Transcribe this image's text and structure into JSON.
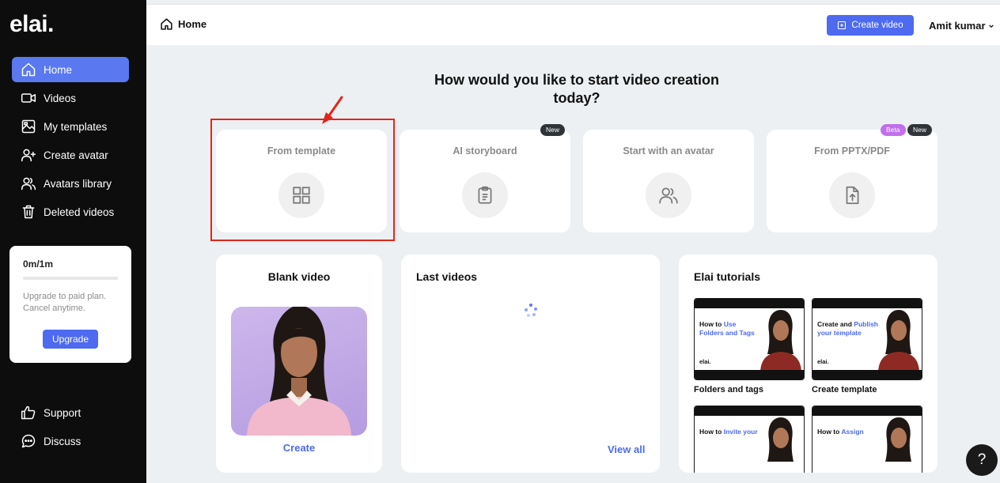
{
  "brand": {
    "logo": "elai."
  },
  "sidebar": {
    "items": [
      {
        "label": "Home",
        "icon": "home-icon",
        "active": true
      },
      {
        "label": "Videos",
        "icon": "video-camera-icon"
      },
      {
        "label": "My templates",
        "icon": "templates-icon"
      },
      {
        "label": "Create avatar",
        "icon": "user-plus-icon"
      },
      {
        "label": "Avatars library",
        "icon": "users-icon"
      },
      {
        "label": "Deleted videos",
        "icon": "trash-icon"
      }
    ],
    "bottom_items": [
      {
        "label": "Support",
        "icon": "thumbs-up-icon"
      },
      {
        "label": "Discuss",
        "icon": "chat-icon"
      }
    ],
    "plan": {
      "usage": "0m/1m",
      "progress": 0,
      "text_line1": "Upgrade to paid plan.",
      "text_line2": "Cancel anytime.",
      "upgrade_label": "Upgrade"
    }
  },
  "topbar": {
    "breadcrumb": "Home",
    "create_video_label": "Create video",
    "user_name": "Amit kumar"
  },
  "main": {
    "headline_line1": "How would you like to start video creation",
    "headline_line2": "today?",
    "options": [
      {
        "label": "From template",
        "icon": "grid-icon",
        "badges": []
      },
      {
        "label": "AI storyboard",
        "icon": "clipboard-icon",
        "badges": [
          "New"
        ]
      },
      {
        "label": "Start with an avatar",
        "icon": "users-icon",
        "badges": []
      },
      {
        "label": "From PPTX/PDF",
        "icon": "file-upload-icon",
        "badges": [
          "Beta",
          "New"
        ]
      }
    ],
    "blank_video": {
      "title": "Blank video",
      "action": "Create"
    },
    "last_videos": {
      "title": "Last videos",
      "action": "View all"
    },
    "tutorials": {
      "title": "Elai tutorials",
      "items": [
        {
          "thumb_prefix": "How to ",
          "thumb_accent": "Use Folders and Tags",
          "thumb_suffix": "",
          "label": "Folders and tags"
        },
        {
          "thumb_prefix": "Create and ",
          "thumb_accent": "Publish your template",
          "thumb_suffix": "",
          "label": "Create template"
        },
        {
          "thumb_prefix": "How to ",
          "thumb_accent": "Invite your",
          "thumb_suffix": "",
          "label": ""
        },
        {
          "thumb_prefix": "How to ",
          "thumb_accent": "Assign",
          "thumb_suffix": "",
          "label": ""
        }
      ],
      "thumb_logo": "elai."
    }
  },
  "help_label": "?",
  "colors": {
    "accent": "#4d6af0",
    "sidebar_bg": "#0d0d0d",
    "highlight": "#e0261b"
  }
}
